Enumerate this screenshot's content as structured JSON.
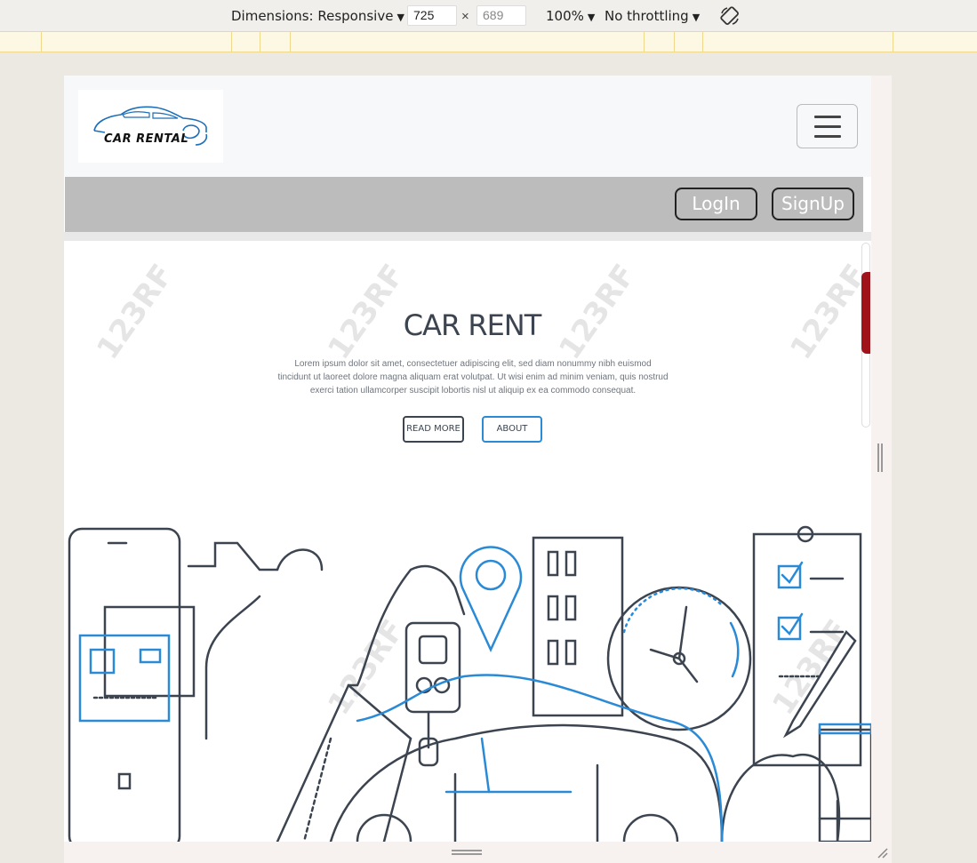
{
  "devtools": {
    "dimensions_label": "Dimensions: Responsive",
    "width": "725",
    "height": "689",
    "zoom": "100%",
    "throttling": "No throttling",
    "caret": "▼",
    "times": "×",
    "rotate_icon": "rotate-icon"
  },
  "navbar": {
    "logo_text": "CAR RENTAL",
    "toggler_icon": "hamburger-menu-icon"
  },
  "auth": {
    "login_label": "LogIn",
    "signup_label": "SignUp"
  },
  "hero": {
    "title": "CAR RENT",
    "text": "Lorem ipsum dolor sit amet, consectetuer adipiscing elit, sed diam nonummy nibh euismod tincidunt ut laoreet dolore magna aliquam erat volutpat. Ut wisi enim ad minim veniam, quis nostrud exerci tation ullamcorper suscipit lobortis nisl ut aliquip ex ea commodo consequat.",
    "read_more_label": "READ MORE",
    "about_label": "ABOUT",
    "watermark": "123RF"
  },
  "colors": {
    "accent_blue": "#2a8ad6",
    "line_dark": "#3c4450",
    "red_tab": "#a0131a"
  }
}
